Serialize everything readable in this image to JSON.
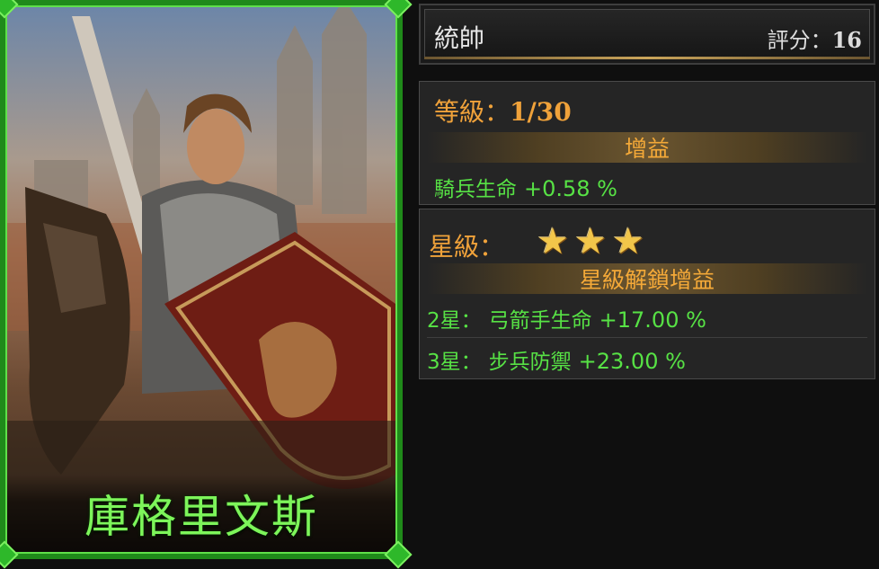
{
  "hero": {
    "name": "庫格里文斯"
  },
  "header": {
    "title": "統帥",
    "score_label": "評分：",
    "score_value": "16"
  },
  "level": {
    "label": "等級：",
    "value": "1/30",
    "bonus_header": "增益",
    "stats": [
      {
        "name": "騎兵生命",
        "value": "+0.58 %"
      }
    ]
  },
  "stars": {
    "label": "星級：",
    "count": 3,
    "unlock_header": "星級解鎖增益",
    "stats": [
      {
        "tier": "2星：",
        "name": "弓箭手生命",
        "value": "+17.00 %"
      },
      {
        "tier": "3星：",
        "name": "步兵防禦",
        "value": "+23.00 %"
      }
    ]
  },
  "colors": {
    "frame_green": "#1f8a1a",
    "name_green": "#7df55a",
    "stat_green": "#57e245",
    "accent_orange": "#f0a23a",
    "star_gold": "#f2c64a"
  }
}
